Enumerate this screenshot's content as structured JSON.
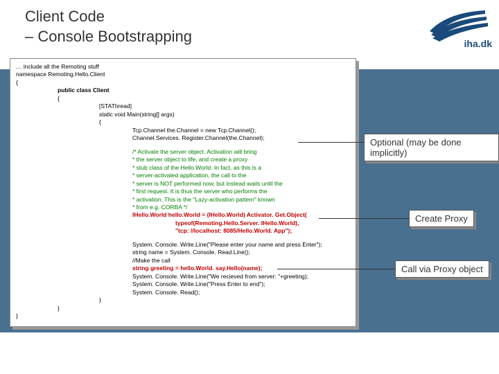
{
  "title_line1": "Client Code",
  "title_line2": "– Console Bootstrapping",
  "logo_text": "iha.dk",
  "code": {
    "l1": "… include all the Remoting stuff",
    "l2": "namespace Remoting.Hello.Client",
    "l3": "{",
    "l4": "public class Client",
    "l5": "{",
    "l6": "[STAThread]",
    "l7": "static void Main(string[] args)",
    "l8": "{",
    "l9": "Tcp.Channel the.Channel = new Tcp.Channel();",
    "l10": "Channel.Services. Register.Channel(the.Channel);",
    "c1": "/* Activate the server object. Activation will bring",
    "c2": " * the server object to life, and create a proxy",
    "c3": " * stub class of the Hello.World. In fact, as this is a",
    "c4": " * server-activated application, the call to the",
    "c5": " * server is NOT performed now, but instead waits until the",
    "c6": " * first request. It is thus the server who performs the",
    "c7": " * activation. This is the \"Lazy-activation pattern\" known",
    "c8": " * from e.g. CORBA */",
    "p1": "IHello.World hello.World = (IHello.World) Activator. Get.Object(",
    "p2": "typeof(Remoting.Hello.Server. IHello.World),",
    "p3": "\"tcp: //localhost: 8085/Hello.World. App\");",
    "s1": "System. Console. Write.Line(\"Please enter your name and press Enter\");",
    "s2": "string name = System. Console. Read.Line();",
    "s3": "//Make the call",
    "call": "string greeting = hello.World. say.Hello(name);",
    "s4": "System. Console. Write.Line(\"We recieved from server: \"+greeting);",
    "s5": "System. Console. Write.Line(\"Press Enter to end\");",
    "s6": "System. Console. Read();",
    "close1": "}",
    "close2": "}",
    "close3": "}"
  },
  "callouts": {
    "opt": "Optional (may be done implicitly)",
    "proxy": "Create Proxy",
    "viaProxy": "Call via Proxy object"
  }
}
